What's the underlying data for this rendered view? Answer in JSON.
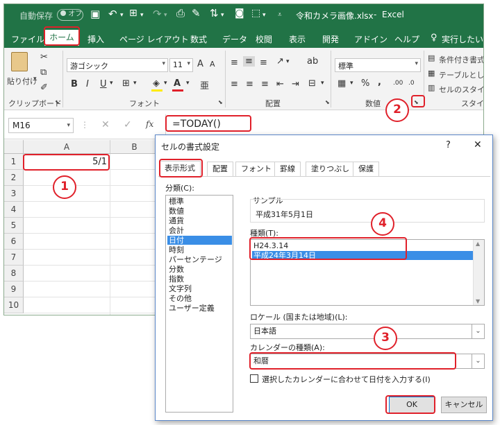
{
  "titlebar": {
    "autosave_label": "自動保存",
    "autosave_state": "オフ",
    "filename": "令和カメラ画像.xlsx",
    "app_name": "Excel"
  },
  "tabs": [
    "ファイル",
    "ホーム",
    "挿入",
    "ページ レイアウト",
    "数式",
    "データ",
    "校閲",
    "表示",
    "開発",
    "アドイン",
    "ヘルプ",
    "実行したいか"
  ],
  "ribbon": {
    "paste_label": "貼り付け",
    "clipboard_group": "クリップボード",
    "font_name": "游ゴシック",
    "font_size": "11",
    "font_group": "フォント",
    "alignment_group": "配置",
    "number_format": "標準",
    "number_group": "数値",
    "conditional_format": "条件付き書式",
    "format_as_table": "テーブルとして",
    "cell_styles": "セルのスタイル",
    "styles_group": "スタイル",
    "bold": "B",
    "italic": "I",
    "underline": "U",
    "grow_font": "A",
    "shrink_font": "A",
    "font_color_letter": "A",
    "percent": "%",
    "comma": ","
  },
  "formula_bar": {
    "name_box": "M16",
    "formula": "=TODAY()",
    "fx": "fx"
  },
  "grid": {
    "columns": [
      "A",
      "B"
    ],
    "rows": [
      "1",
      "2",
      "3",
      "4",
      "5",
      "6",
      "7",
      "8",
      "9",
      "10"
    ],
    "cell_a1": "5/1"
  },
  "dialog": {
    "title": "セルの書式設定",
    "help": "?",
    "close": "✕",
    "tabs": [
      "表示形式",
      "配置",
      "フォント",
      "罫線",
      "塗りつぶし",
      "保護"
    ],
    "category_label": "分類(C):",
    "categories": [
      "標準",
      "数値",
      "通貨",
      "会計",
      "日付",
      "時刻",
      "パーセンテージ",
      "分数",
      "指数",
      "文字列",
      "その他",
      "ユーザー定義"
    ],
    "selected_category": "日付",
    "sample_label": "サンプル",
    "sample_value": "平成31年5月1日",
    "type_label": "種類(T):",
    "types": [
      "H24.3.14",
      "平成24年3月14日"
    ],
    "selected_type": "平成24年3月14日",
    "locale_label": "ロケール (国または地域)(L):",
    "locale_value": "日本語",
    "calendar_label": "カレンダーの種類(A):",
    "calendar_value": "和暦",
    "checkbox_label": "選択したカレンダーに合わせて日付を入力する(I)",
    "ok": "OK",
    "cancel": "キャンセル"
  },
  "callouts": [
    "1",
    "2",
    "3",
    "4"
  ],
  "colors": {
    "excel_green": "#217346",
    "callout_red": "#e0202a",
    "selection_blue": "#3a8ee6"
  },
  "icons": [
    "save-icon",
    "undo-icon",
    "redo-icon",
    "camera-icon",
    "print-preview-icon",
    "paste-icon",
    "cut-icon",
    "copy-icon",
    "format-painter-icon",
    "lightbulb-icon",
    "dialog-launcher-icon"
  ]
}
